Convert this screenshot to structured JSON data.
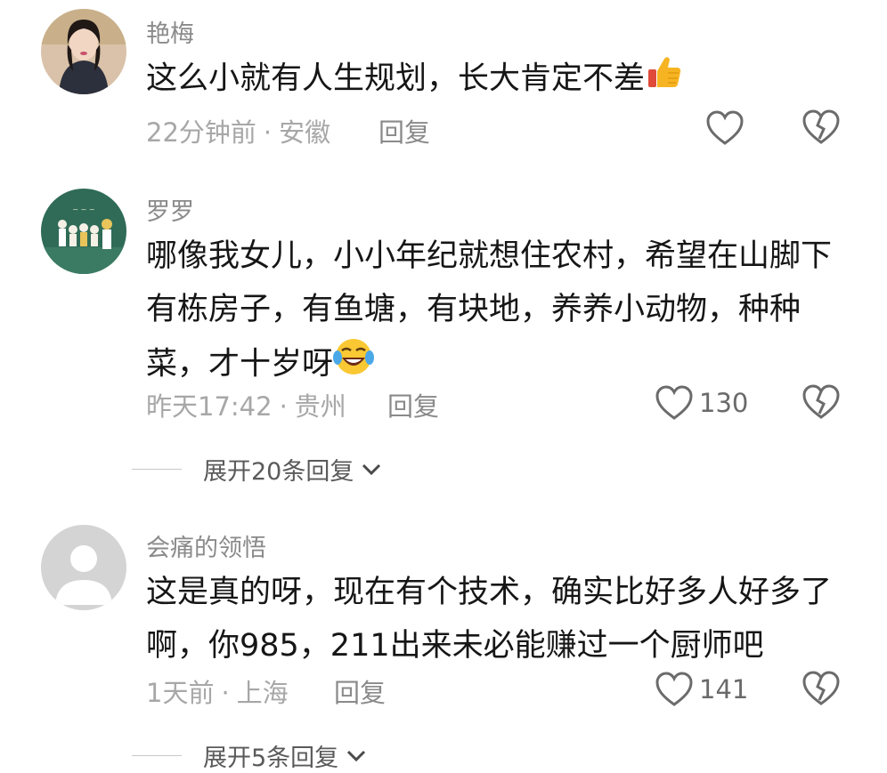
{
  "comments": [
    {
      "name": "艳梅",
      "lines": [
        "这么小就有人生规划，长大肯定不差"
      ],
      "emoji": "thumbs-up-icon",
      "time": "22分钟前",
      "sep": "·",
      "location": "安徽",
      "reply": "回复",
      "likes": ""
    },
    {
      "name": "罗罗",
      "lines": [
        "哪像我女儿，小小年纪就想住农村，希望在山脚下",
        "有栋房子，有鱼塘，有块地，养养小动物，种种",
        "菜，才十岁呀"
      ],
      "emoji": "laughing-tears-icon",
      "time": "昨天17:42",
      "sep": "·",
      "location": "贵州",
      "reply": "回复",
      "likes": "130",
      "expand": "展开20条回复"
    },
    {
      "name": "会痛的领悟",
      "lines": [
        "这是真的呀，现在有个技术，确实比好多人好多了",
        "啊，你985，211出来未必能赚过一个厨师吧"
      ],
      "time": "1天前",
      "sep": "·",
      "location": "上海",
      "reply": "回复",
      "likes": "141",
      "expand": "展开5条回复"
    }
  ],
  "icons": {
    "like": "heart-outline-icon",
    "dislike": "broken-heart-icon",
    "expand": "chevron-down-icon"
  }
}
